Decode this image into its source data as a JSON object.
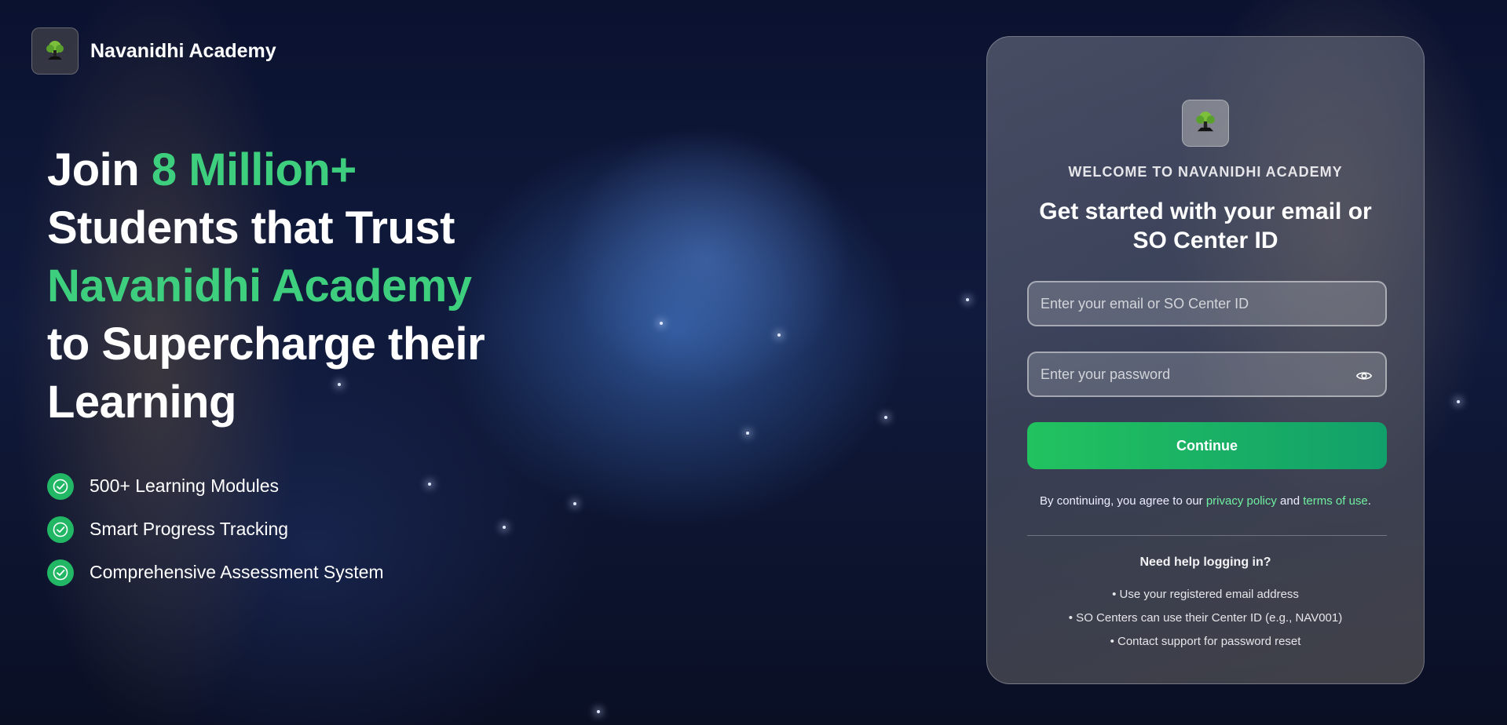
{
  "brand": {
    "name": "Navanidhi Academy",
    "logo_icon": "bonsai-tree-logo"
  },
  "hero": {
    "line1_prefix": "Join ",
    "line1_accent": "8 Million+",
    "line2": "Students that Trust",
    "line3_accent": "Navanidhi Academy",
    "line4": "to Supercharge their",
    "line5": "Learning"
  },
  "features": [
    {
      "label": "500+ Learning Modules",
      "icon": "check-circle-icon"
    },
    {
      "label": "Smart Progress Tracking",
      "icon": "check-circle-icon"
    },
    {
      "label": "Comprehensive Assessment System",
      "icon": "check-circle-icon"
    }
  ],
  "login": {
    "welcome": "WELCOME TO NAVANIDHI ACADEMY",
    "headline": "Get started with your email or SO Center ID",
    "email_placeholder": "Enter your email or SO Center ID",
    "email_value": "",
    "password_placeholder": "Enter your password",
    "password_value": "",
    "continue_label": "Continue",
    "terms_prefix": "By continuing, you agree to our ",
    "privacy_link": "privacy policy",
    "terms_and": " and ",
    "terms_link": "terms of use",
    "terms_suffix": ".",
    "help_title": "Need help logging in?",
    "help_items": [
      "• Use your registered email address",
      "• SO Centers can use their Center ID (e.g., NAV001)",
      "• Contact support for password reset"
    ]
  },
  "colors": {
    "accent_green": "#3ecf7e",
    "button_green": "#22c25f",
    "link_green": "#6ff0a0"
  }
}
